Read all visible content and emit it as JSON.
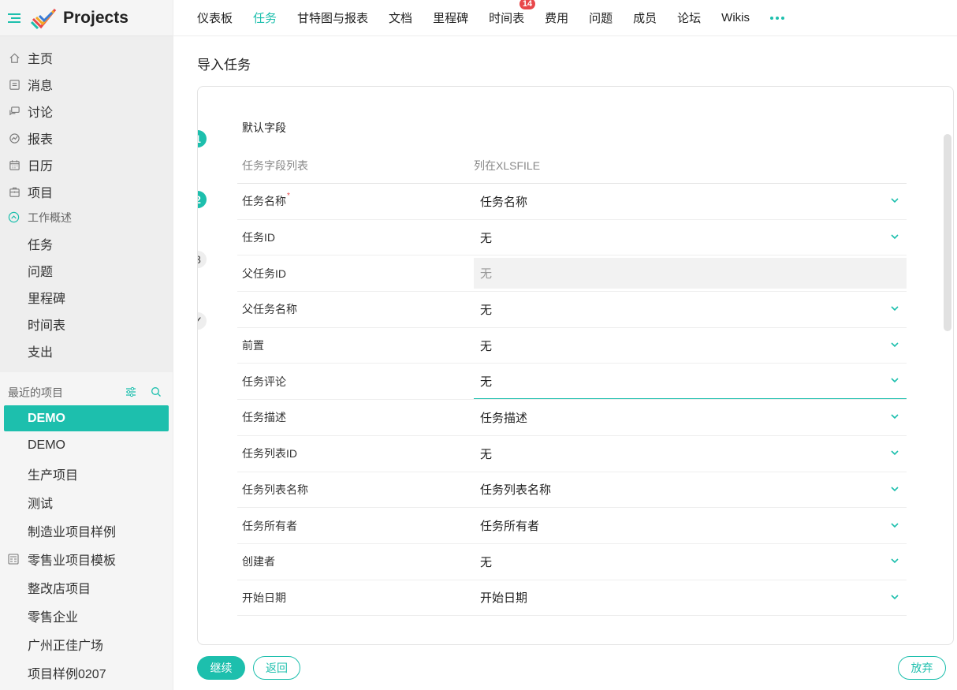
{
  "app": {
    "name": "Projects"
  },
  "sidebar": {
    "main": [
      {
        "label": "主页",
        "icon": "home-icon"
      },
      {
        "label": "消息",
        "icon": "feed-icon"
      },
      {
        "label": "讨论",
        "icon": "discuss-icon"
      },
      {
        "label": "报表",
        "icon": "report-icon"
      },
      {
        "label": "日历",
        "icon": "calendar-icon"
      },
      {
        "label": "项目",
        "icon": "briefcase-icon"
      }
    ],
    "work_overview": {
      "title": "工作概述",
      "items": [
        "任务",
        "问题",
        "里程碑",
        "时间表",
        "支出"
      ]
    },
    "recent": {
      "title": "最近的项目",
      "projects": [
        "DEMO",
        "DEMO",
        "生产项目",
        "测试",
        "制造业项目样例",
        "零售业项目模板",
        "整改店项目",
        "零售企业",
        "广州正佳广场",
        "项目样例0207"
      ]
    }
  },
  "tabs": [
    {
      "label": "仪表板"
    },
    {
      "label": "任务"
    },
    {
      "label": "甘特图与报表"
    },
    {
      "label": "文档"
    },
    {
      "label": "里程碑"
    },
    {
      "label": "时间表",
      "badge": "14"
    },
    {
      "label": "费用"
    },
    {
      "label": "问题"
    },
    {
      "label": "成员"
    },
    {
      "label": "论坛"
    },
    {
      "label": "Wikis"
    }
  ],
  "page": {
    "title": "导入任务",
    "section_title": "默认字段",
    "col_field": "任务字段列表",
    "col_file": "列在XLSFILE",
    "steps": [
      "1",
      "2",
      "3",
      "✓"
    ],
    "active_step": 2
  },
  "fields": [
    {
      "label": "任务名称",
      "required": "*",
      "value": "任务名称"
    },
    {
      "label": "任务ID",
      "value": "无"
    },
    {
      "label": "父任务ID",
      "value": "无",
      "disabled": true
    },
    {
      "label": "父任务名称",
      "value": "无"
    },
    {
      "label": "前置",
      "value": "无"
    },
    {
      "label": "任务评论",
      "value": "无",
      "focused": true
    },
    {
      "label": "任务描述",
      "value": "任务描述"
    },
    {
      "label": "任务列表ID",
      "value": "无"
    },
    {
      "label": "任务列表名称",
      "value": "任务列表名称"
    },
    {
      "label": "任务所有者",
      "value": "任务所有者"
    },
    {
      "label": "创建者",
      "value": "无"
    },
    {
      "label": "开始日期",
      "value": "开始日期"
    }
  ],
  "buttons": {
    "continue": "继续",
    "back": "返回",
    "discard": "放弃"
  },
  "colors": {
    "accent": "#1dbfad",
    "badge": "#e8484b"
  }
}
